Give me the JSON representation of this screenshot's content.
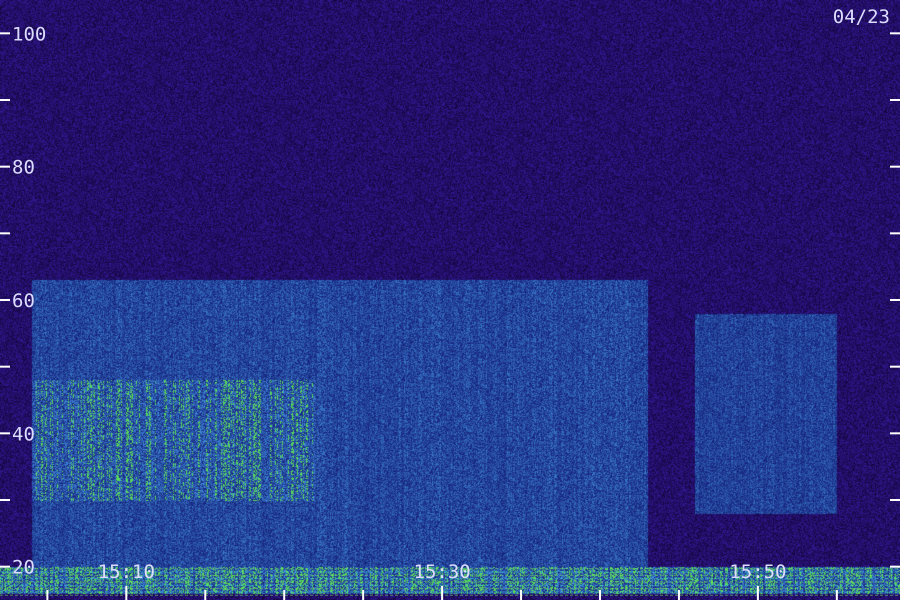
{
  "date_label": "04/23",
  "colors": {
    "background": "#1c0a4a",
    "noise_low": "#2a1480",
    "band_mid": "#2c4ad8",
    "band_high": "#5aa8f0",
    "line_green": "#7cf05a",
    "line_cyan": "#40e0d8",
    "tick": "#ffffff",
    "label": "#dcdcff"
  },
  "chart_data": {
    "type": "heatmap",
    "title": "",
    "xlabel": "",
    "ylabel": "",
    "ylim": [
      15,
      105
    ],
    "xlim": [
      "15:02",
      "15:59"
    ],
    "y_ticks": [
      {
        "value": 20,
        "label": "20"
      },
      {
        "value": 40,
        "label": "40"
      },
      {
        "value": 60,
        "label": "60"
      },
      {
        "value": 80,
        "label": "80"
      },
      {
        "value": 100,
        "label": "100"
      }
    ],
    "y_minor_ticks": [
      30,
      50,
      70,
      90
    ],
    "x_ticks": [
      {
        "value": "15:10",
        "label": "15:10"
      },
      {
        "value": "15:30",
        "label": "15:30"
      },
      {
        "value": "15:50",
        "label": "15:50"
      }
    ],
    "x_minor_ticks": [
      "15:05",
      "15:15",
      "15:20",
      "15:25",
      "15:35",
      "15:40",
      "15:45",
      "15:55"
    ],
    "grid": false,
    "bands": [
      {
        "t_start": "15:04",
        "t_end": "15:43",
        "f_low": 20,
        "f_high": 63,
        "intensity": 0.55
      },
      {
        "t_start": "15:04",
        "t_end": "15:22",
        "f_low": 30,
        "f_high": 48,
        "intensity": 0.8
      },
      {
        "t_start": "15:46",
        "t_end": "15:55",
        "f_low": 28,
        "f_high": 58,
        "intensity": 0.5
      },
      {
        "t_start": "15:02",
        "t_end": "15:59",
        "f_low": 16,
        "f_high": 20,
        "intensity": 0.9
      }
    ]
  }
}
